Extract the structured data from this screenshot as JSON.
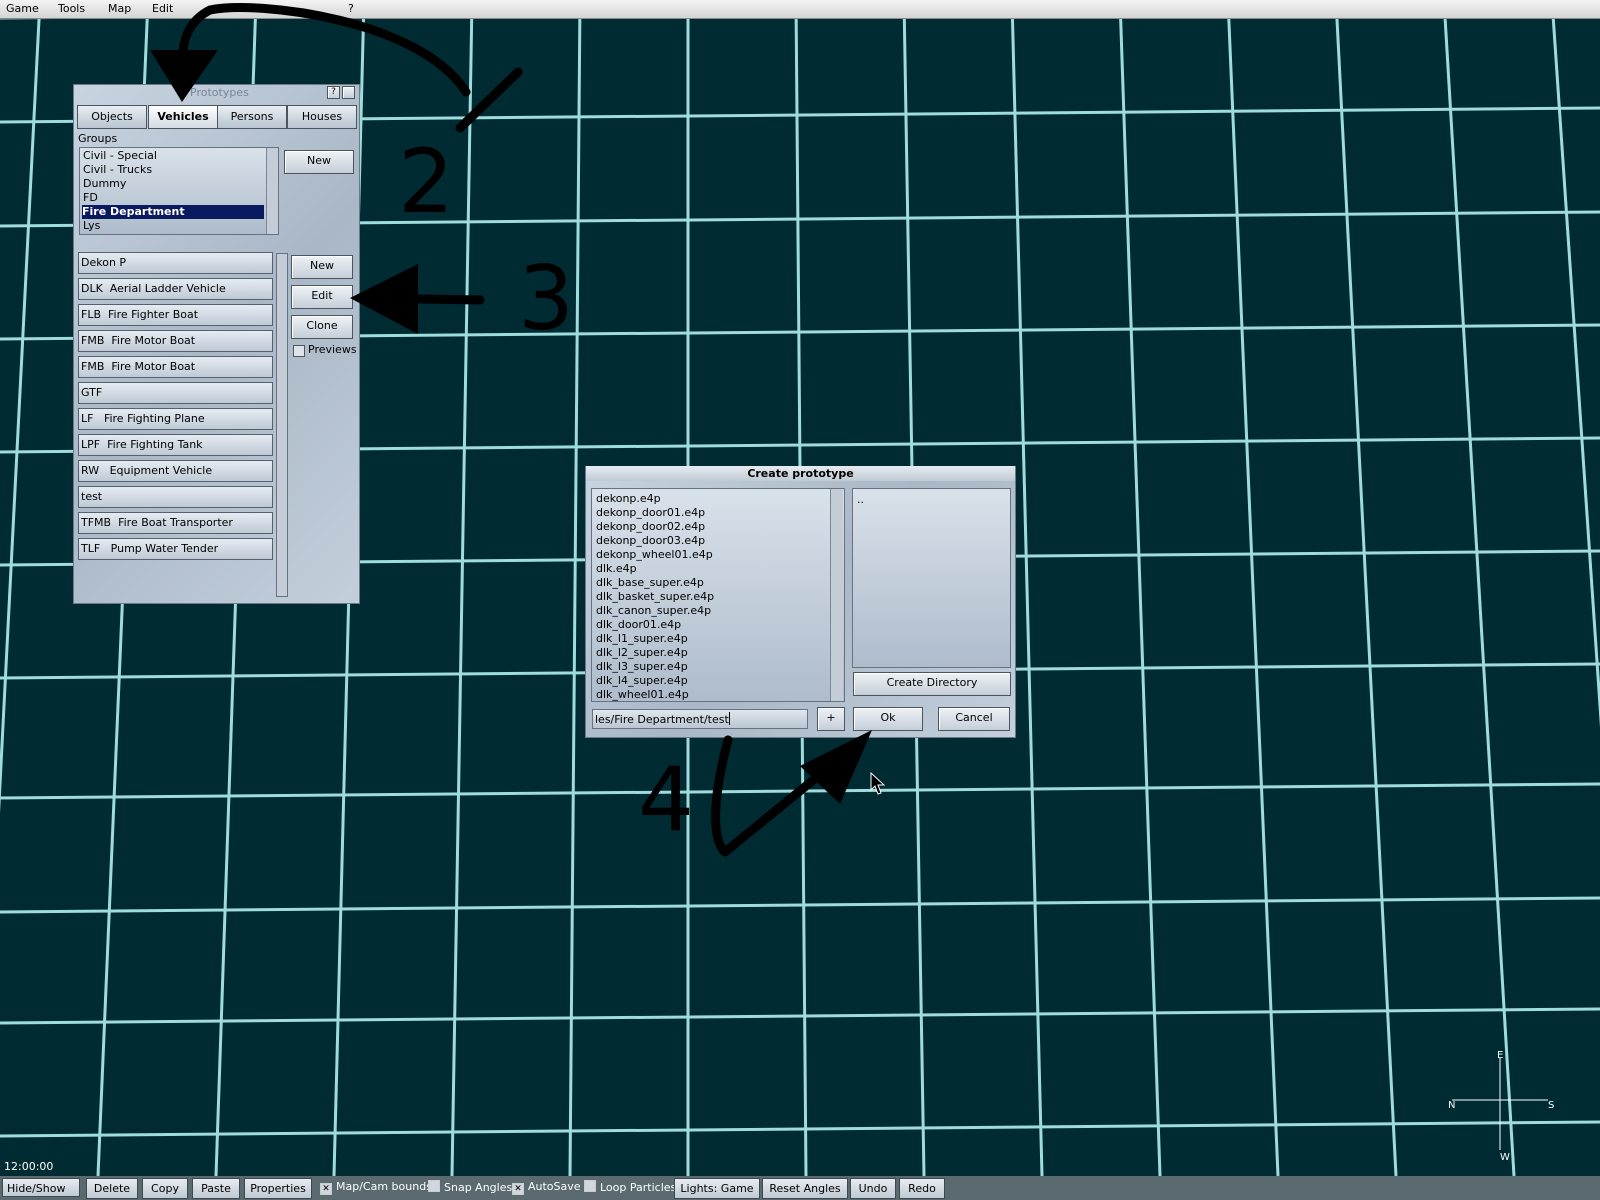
{
  "menu": [
    "Game",
    "Tools",
    "Map",
    "Edit",
    "?"
  ],
  "prototypes_window": {
    "title": "Prototypes",
    "tabs": [
      "Objects",
      "Vehicles",
      "Persons",
      "Houses"
    ],
    "active_tab": "Vehicles",
    "groups_label": "Groups",
    "groups": [
      "Civil - Special",
      "Civil - Trucks",
      "Dummy",
      "FD",
      "Fire Department",
      "Lys"
    ],
    "selected_group": "Fire Department",
    "group_new_label": "New",
    "vehicles": [
      "Dekon P",
      "DLK  Aerial Ladder Vehicle",
      "FLB  Fire Fighter Boat",
      "FMB  Fire Motor Boat",
      "FMB  Fire Motor Boat",
      "GTF",
      "LF   Fire Fighting Plane",
      "LPF  Fire Fighting Tank",
      "RW   Equipment Vehicle",
      "test",
      "TFMB  Fire Boat Transporter",
      "TLF   Pump Water Tender"
    ],
    "buttons": {
      "new": "New",
      "edit": "Edit",
      "clone": "Clone"
    },
    "previews_label": "Previews"
  },
  "create_dialog": {
    "title": "Create prototype",
    "files": [
      "dekonp.e4p",
      "dekonp_door01.e4p",
      "dekonp_door02.e4p",
      "dekonp_door03.e4p",
      "dekonp_wheel01.e4p",
      "dlk.e4p",
      "dlk_base_super.e4p",
      "dlk_basket_super.e4p",
      "dlk_canon_super.e4p",
      "dlk_door01.e4p",
      "dlk_l1_super.e4p",
      "dlk_l2_super.e4p",
      "dlk_l3_super.e4p",
      "dlk_l4_super.e4p",
      "dlk_wheel01.e4p"
    ],
    "dirs": [
      ".."
    ],
    "create_directory_label": "Create Directory",
    "path_value": "les/Fire Department/test",
    "plus_label": "+",
    "ok_label": "Ok",
    "cancel_label": "Cancel"
  },
  "annotations": [
    "2",
    "3",
    "4"
  ],
  "status": {
    "time": "12:00:00"
  },
  "toolbar": {
    "hide_show": "Hide/Show",
    "delete": "Delete",
    "copy": "Copy",
    "paste": "Paste",
    "properties": "Properties",
    "map_cam_bounds": "Map/Cam bounds",
    "map_cam_bounds_checked": true,
    "snap_angles": "Snap Angles",
    "snap_angles_checked": false,
    "autosave": "AutoSave",
    "autosave_checked": true,
    "loop_particles": "Loop Particles",
    "loop_particles_checked": false,
    "lights": "Lights: Game",
    "reset_angles": "Reset Angles",
    "undo": "Undo",
    "redo": "Redo"
  },
  "compass": {
    "n": "N",
    "s": "S",
    "e": "E",
    "w": "W"
  },
  "colors": {
    "background": "#002b33",
    "grid": "#a8e0e0",
    "selection": "#0a1a5e"
  }
}
